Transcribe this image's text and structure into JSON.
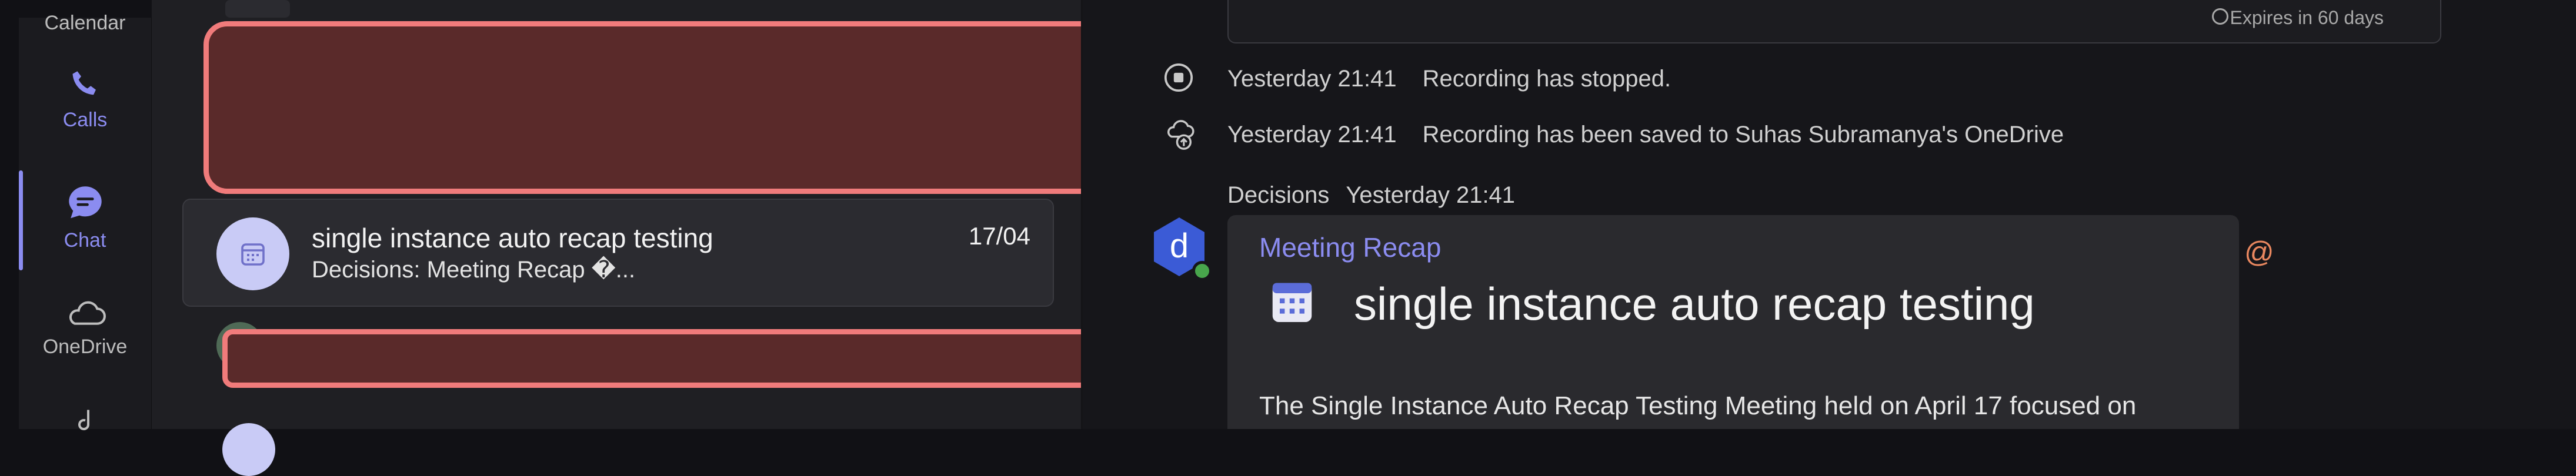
{
  "rail": {
    "items": [
      {
        "label": "Calendar",
        "icon": "calendar-icon"
      },
      {
        "label": "Calls",
        "icon": "phone-icon"
      },
      {
        "label": "Chat",
        "icon": "chat-icon",
        "active": true
      },
      {
        "label": "OneDrive",
        "icon": "cloud-icon"
      }
    ],
    "accent": "#8b8cf0"
  },
  "chatlist": {
    "selected": {
      "title": "single instance auto recap testing",
      "date": "17/04",
      "preview": "Decisions: Meeting Recap �..."
    }
  },
  "thread": {
    "top_notice": {
      "expires": "Expires in 60 days"
    },
    "events": [
      {
        "time": "Yesterday 21:41",
        "text": "Recording has stopped.",
        "icon": "stop-circle-icon"
      },
      {
        "time": "Yesterday 21:41",
        "text": "Recording has been saved to Suhas Subramanya's OneDrive",
        "icon": "cloud-upload-icon"
      }
    ],
    "message": {
      "sender": "Decisions",
      "time": "Yesterday 21:41",
      "avatar_letter": "d",
      "app_name": "Meeting Recap",
      "title": "single instance auto recap testing",
      "body": "The Single Instance Auto Recap Testing Meeting held on April 17 focused on"
    },
    "mention_symbol": "@"
  }
}
